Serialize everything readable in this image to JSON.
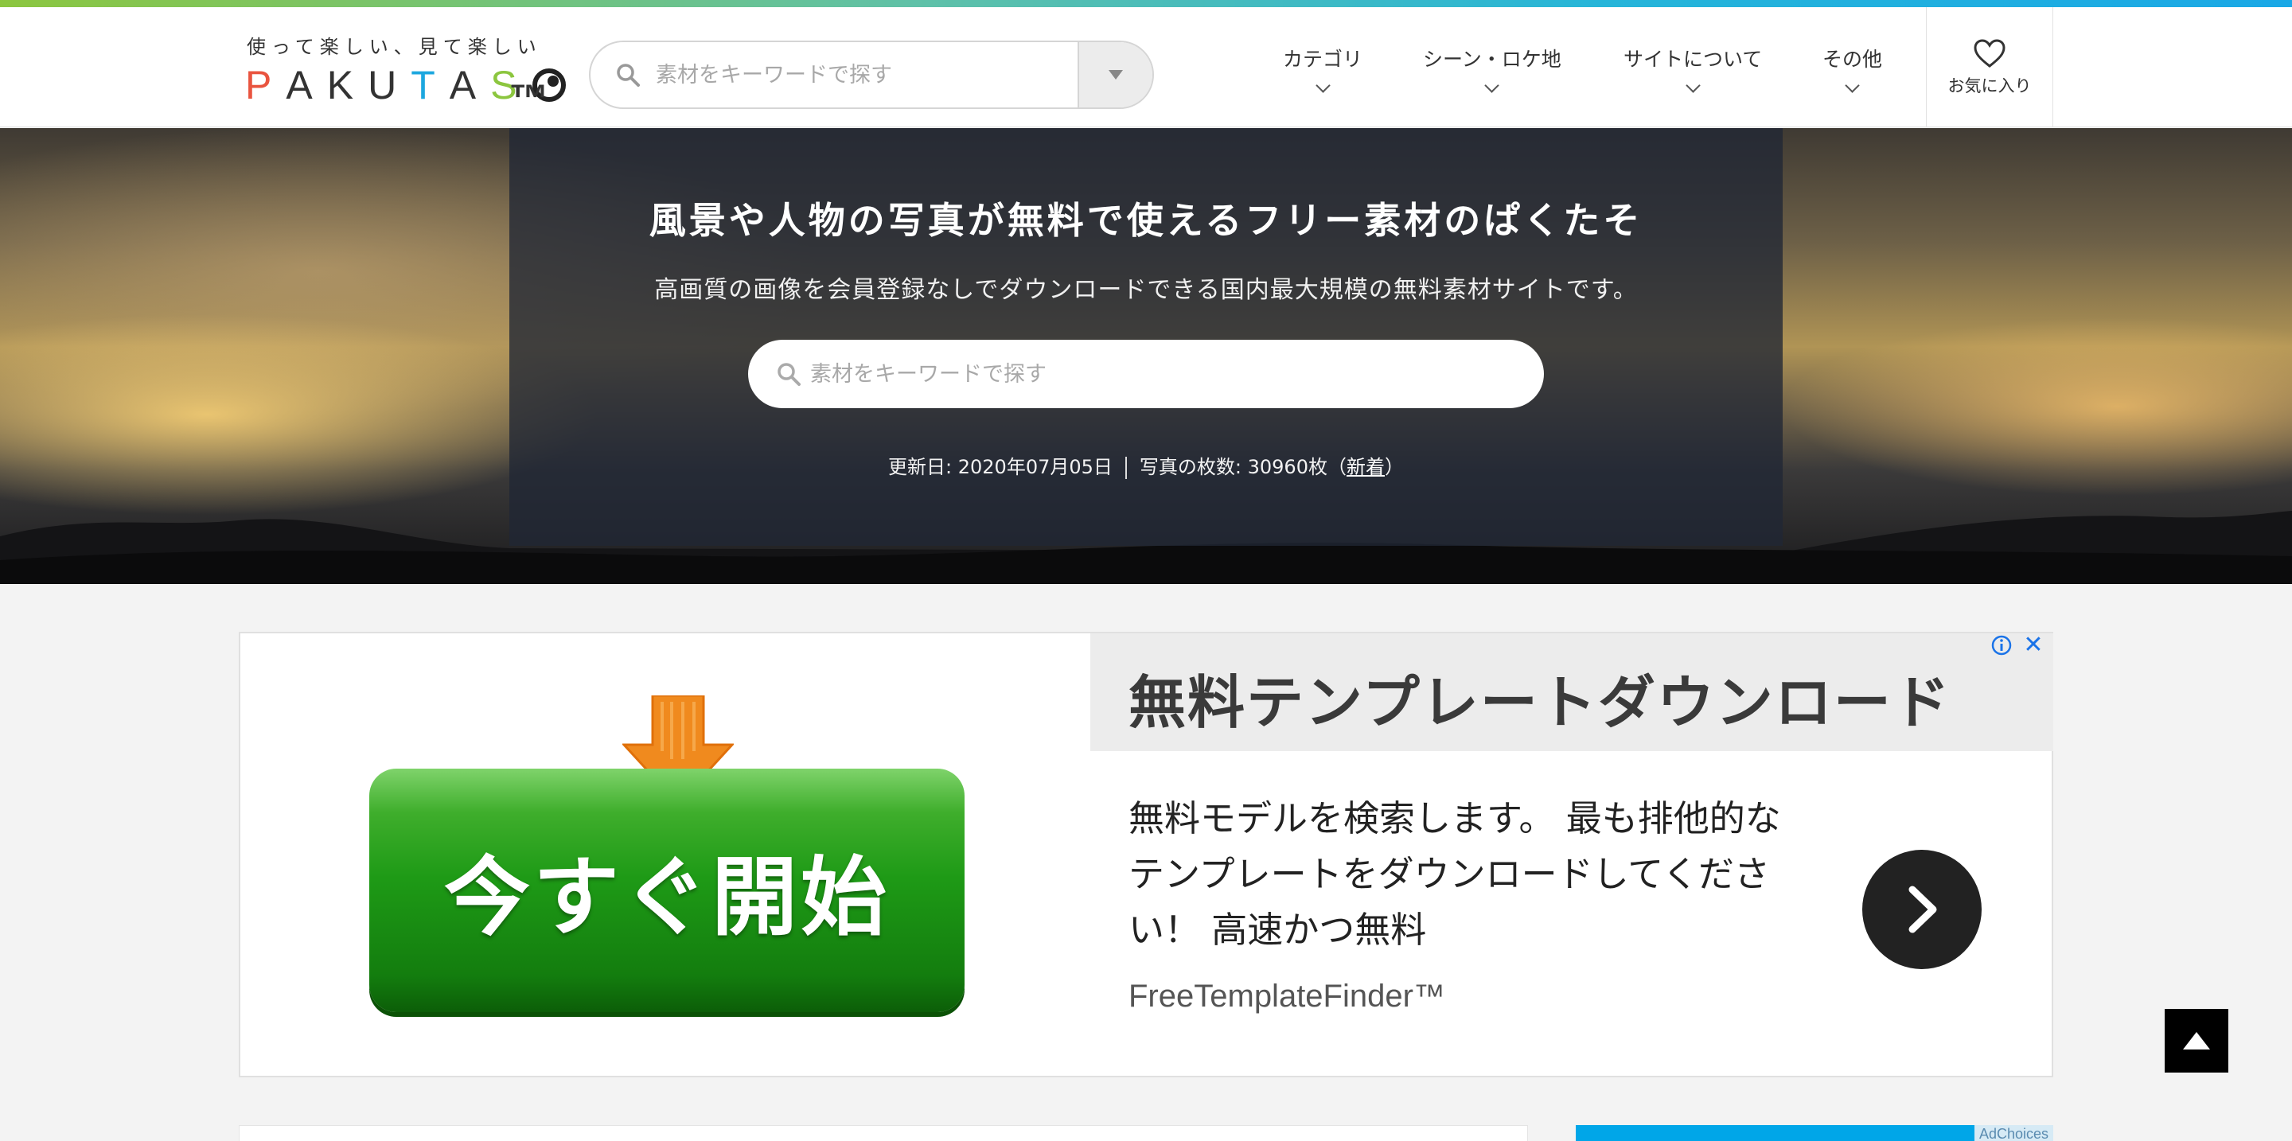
{
  "header": {
    "logo_tagline": "使って楽しい、見て楽しい",
    "logo_letters": [
      "P",
      "A",
      "K",
      "U",
      "T",
      "A",
      "S"
    ],
    "logo_colors": [
      "#e9543f",
      "#333333",
      "#333333",
      "#333333",
      "#1ca7df",
      "#333333",
      "#8cc63f"
    ],
    "logo_tm": "™",
    "search_placeholder": "素材をキーワードで探す",
    "nav": [
      {
        "label": "カテゴリ"
      },
      {
        "label": "シーン・ロケ地"
      },
      {
        "label": "サイトについて"
      },
      {
        "label": "その他"
      }
    ],
    "favorites_label": "お気に入り"
  },
  "hero": {
    "title": "風景や人物の写真が無料で使えるフリー素材のぱくたそ",
    "subtitle": "高画質の画像を会員登録なしでダウンロードできる国内最大規模の無料素材サイトです。",
    "search_placeholder": "素材をキーワードで探す",
    "updated_label": "更新日: 2020年07月05日",
    "count_label": "写真の枚数: 30960枚（",
    "new_link": "新着",
    "count_suffix": "）"
  },
  "ad": {
    "button_text": "今すぐ開始",
    "headline": "無料テンプレートダウンロード",
    "body": "無料モデルを検索します。 最も排他的なテンプレートをダウンロードしてください！ 高速かつ無料",
    "brand": "FreeTemplateFinder™",
    "close": "✕",
    "adchoices": "AdChoices"
  },
  "colors": {
    "gradient_start": "#8cc63f",
    "gradient_end": "#1aa8e6",
    "ad_green": "#1e9a16",
    "ad_arrow": "#f08a1e",
    "side_ad_blue": "#00a6e8"
  }
}
